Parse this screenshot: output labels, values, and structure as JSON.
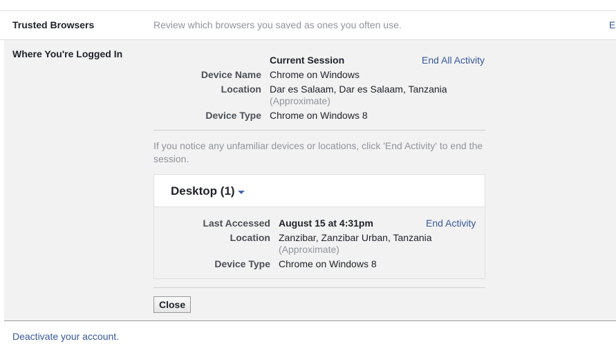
{
  "rows": {
    "trusted": {
      "title": "Trusted Browsers",
      "description": "Review which browsers you saved as ones you often use.",
      "edit_link": "E"
    },
    "logged_in": {
      "title": "Where You're Logged In",
      "end_all_link": "End All Activity",
      "current_session": {
        "heading": "Current Session",
        "device_name_label": "Device Name",
        "device_name": "Chrome on Windows",
        "location_label": "Location",
        "location": "Dar es Salaam, Dar es Salaam, Tanzania",
        "location_note": "(Approximate)",
        "device_type_label": "Device Type",
        "device_type": "Chrome on Windows 8"
      },
      "notice": "If you notice any unfamiliar devices or locations, click 'End Activity' to end the session.",
      "desktop": {
        "title": "Desktop (1)",
        "last_accessed_label": "Last Accessed",
        "last_accessed": "August 15 at 4:31pm",
        "end_activity_link": "End Activity",
        "location_label": "Location",
        "location": "Zanzibar, Zanzibar Urban, Tanzania",
        "location_note": "(Approximate)",
        "device_type_label": "Device Type",
        "device_type": "Chrome on Windows 8"
      },
      "close_label": "Close"
    }
  },
  "footer": {
    "deactivate_link": "Deactivate your account."
  },
  "colors": {
    "link": "#365899",
    "muted": "#90949c",
    "panel_bg": "#f2f2f2"
  }
}
